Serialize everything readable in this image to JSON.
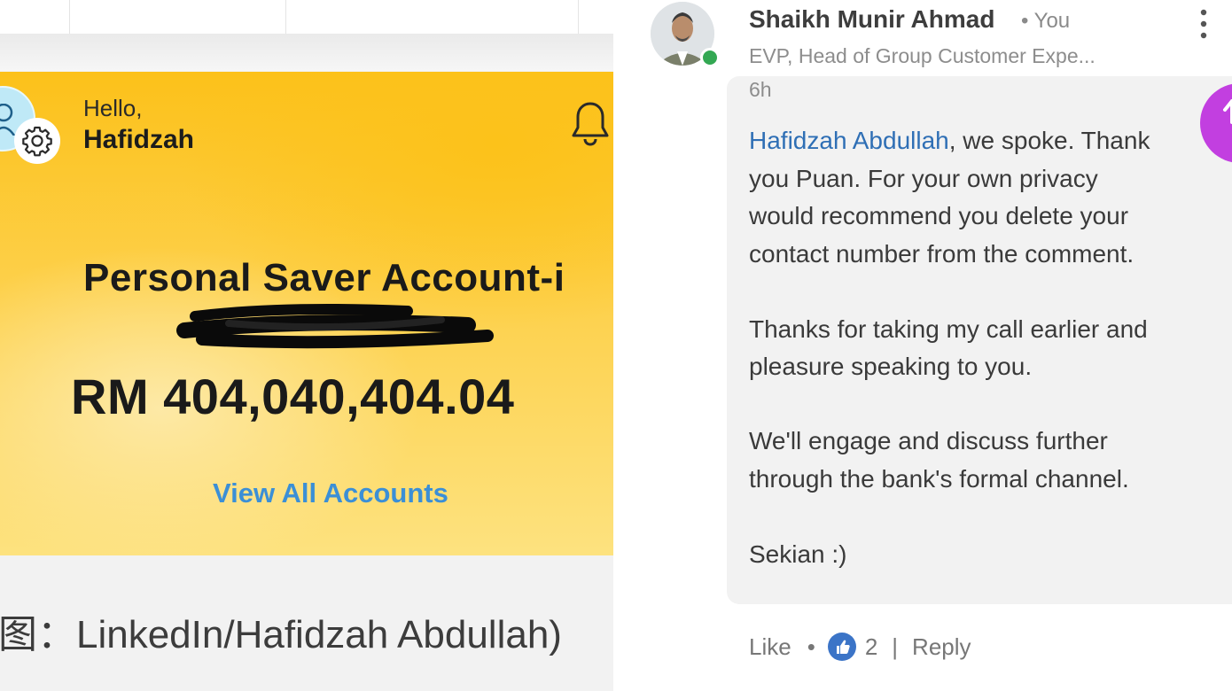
{
  "left_panel": {
    "greeting": "Hello,",
    "user_name": "Hafidzah",
    "account_title": "Personal Saver Account-i",
    "balance": "RM 404,040,404.04",
    "view_all_label": "View All Accounts",
    "caption": "图：LinkedIn/Hafidzah Abdullah)"
  },
  "comment": {
    "author": "Shaikh Munir Ahmad",
    "relation": "• You",
    "headline": "EVP, Head of Group Customer Expe...",
    "time": "6h",
    "mention": "Hafidzah Abdullah",
    "lines": [
      ", we spoke. Thank",
      "you Puan. For your own privacy",
      "would recommend you delete your",
      "contact number from the comment.",
      "Thanks for taking my call earlier and",
      "pleasure speaking to you.",
      "We'll engage and discuss further",
      "through the bank's formal channel.",
      "Sekian :)"
    ],
    "like_label": "Like",
    "dot": "•",
    "like_count": "2",
    "divider": "|",
    "reply_label": "Reply"
  },
  "colors": {
    "card_yellow": "#fcc11a",
    "link_blue": "#3b8fd6",
    "mention_blue": "#2f6fb5",
    "fab_purple": "#c23fe0",
    "online_green": "#33a853"
  }
}
